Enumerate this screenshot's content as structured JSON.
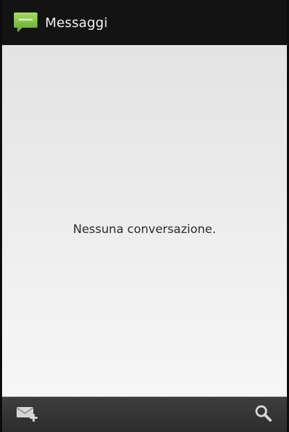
{
  "action_bar": {
    "title": "Messaggi",
    "icon": "speech-bubble-icon",
    "icon_color": "#7cc242"
  },
  "content": {
    "empty_message": "Nessuna conversazione."
  },
  "bottom_bar": {
    "compose_icon": "compose-message-icon",
    "search_icon": "search-icon"
  }
}
